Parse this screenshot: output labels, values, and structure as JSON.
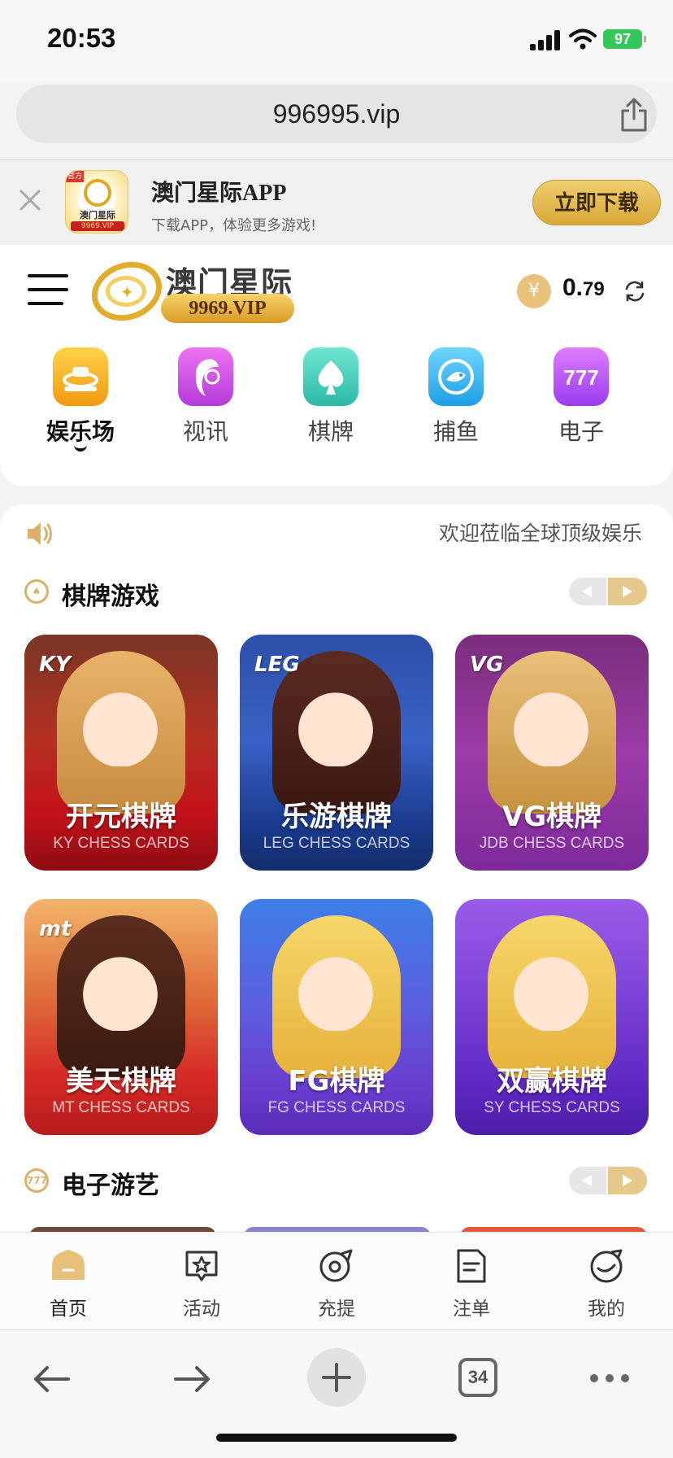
{
  "status_bar": {
    "time": "20:53",
    "battery": "97"
  },
  "browser": {
    "url": "996995.vip",
    "tab_count": "34"
  },
  "app_banner": {
    "icon_tag": "官方",
    "icon_name": "澳门星际",
    "icon_vip": "9969.VIP",
    "title": "澳门星际APP",
    "subtitle": "下载APP，体验更多游戏!",
    "download_label": "立即下载"
  },
  "header": {
    "logo_cn": "澳门星际",
    "logo_en": "9969.VIP",
    "currency_symbol": "¥",
    "balance_int": "0.",
    "balance_dec": "79"
  },
  "categories": [
    {
      "label": "娱乐场",
      "active": true,
      "color": "#f5b21c"
    },
    {
      "label": "视讯",
      "active": false,
      "color": "#d04fe0"
    },
    {
      "label": "棋牌",
      "active": false,
      "color": "#3fd3c0"
    },
    {
      "label": "捕鱼",
      "active": false,
      "color": "#38b6ee"
    },
    {
      "label": "电子",
      "active": false,
      "color": "#b04df0"
    }
  ],
  "marquee": "欢迎莅临全球顶级娱乐",
  "sections": {
    "chess_title": "棋牌游戏",
    "slots_title": "电子游艺",
    "slots_icon_text": "777"
  },
  "chess_games": [
    {
      "title": "开元棋牌",
      "subtitle": "KY CHESS CARDS",
      "brand": "KY"
    },
    {
      "title": "乐游棋牌",
      "subtitle": "LEG CHESS CARDS",
      "brand": "LEG"
    },
    {
      "title": "VG棋牌",
      "subtitle": "JDB CHESS CARDS",
      "brand": "VG"
    },
    {
      "title": "美天棋牌",
      "subtitle": "MT CHESS CARDS",
      "brand": "mt"
    },
    {
      "title": "FG棋牌",
      "subtitle": "FG CHESS CARDS",
      "brand": ""
    },
    {
      "title": "双赢棋牌",
      "subtitle": "SY CHESS CARDS",
      "brand": ""
    }
  ],
  "bottom_nav": [
    {
      "label": "首页",
      "icon": "home-icon"
    },
    {
      "label": "活动",
      "icon": "star-badge-icon"
    },
    {
      "label": "充提",
      "icon": "wallet-icon"
    },
    {
      "label": "注单",
      "icon": "document-icon"
    },
    {
      "label": "我的",
      "icon": "profile-icon"
    }
  ]
}
